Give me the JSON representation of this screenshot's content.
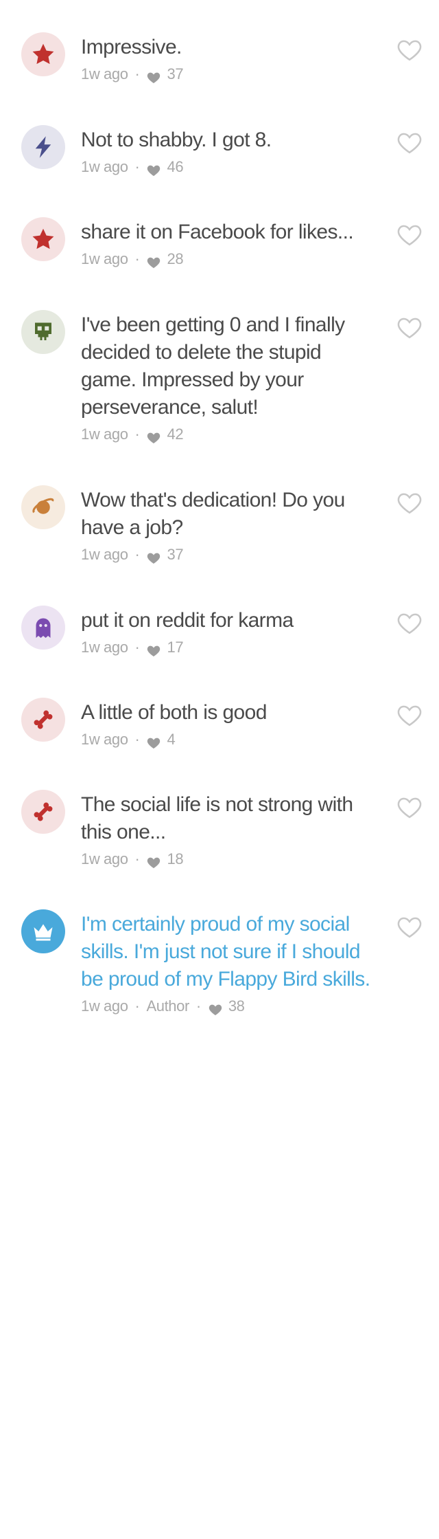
{
  "comments": [
    {
      "text": "Impressive.",
      "time": "1w ago",
      "likes": "37",
      "icon": "star-icon",
      "icon_color": "#c0312e",
      "bg": "#f5e1e1",
      "author": false,
      "author_label": ""
    },
    {
      "text": "Not to shabby.  I got 8.",
      "time": "1w ago",
      "likes": "46",
      "icon": "lightning-icon",
      "icon_color": "#4a4f8c",
      "bg": "#e4e4ee",
      "author": false,
      "author_label": ""
    },
    {
      "text": "share it on Facebook for likes...",
      "time": "1w ago",
      "likes": "28",
      "icon": "star-icon",
      "icon_color": "#c0312e",
      "bg": "#f5e1e1",
      "author": false,
      "author_label": ""
    },
    {
      "text": "I've been getting 0 and I finally decided to delete the stupid game. Impressed by your perseverance, salut!",
      "time": "1w ago",
      "likes": "42",
      "icon": "skull-icon",
      "icon_color": "#4f6b2e",
      "bg": "#e5e9df",
      "author": false,
      "author_label": ""
    },
    {
      "text": "Wow that's dedication! Do you have a job?",
      "time": "1w ago",
      "likes": "37",
      "icon": "planet-icon",
      "icon_color": "#c9803a",
      "bg": "#f6ebdf",
      "author": false,
      "author_label": ""
    },
    {
      "text": "put it on reddit for karma",
      "time": "1w ago",
      "likes": "17",
      "icon": "ghost-icon",
      "icon_color": "#7b4bb0",
      "bg": "#ece3f2",
      "author": false,
      "author_label": ""
    },
    {
      "text": "A little of both is good",
      "time": "1w ago",
      "likes": "4",
      "icon": "bone-icon",
      "icon_color": "#c0312e",
      "bg": "#f5e1e1",
      "author": false,
      "author_label": ""
    },
    {
      "text": "The social life is not strong with this one...",
      "time": "1w ago",
      "likes": "18",
      "icon": "bone-icon",
      "icon_color": "#c0312e",
      "bg": "#f5e1e1",
      "author": false,
      "author_label": ""
    },
    {
      "text": "I'm certainly proud of my social skills. I'm just not sure if I should be proud of my Flappy Bird skills.",
      "time": "1w ago",
      "likes": "38",
      "icon": "crown-icon",
      "icon_color": "#ffffff",
      "bg": "#49a9db",
      "author": true,
      "author_label": "Author"
    }
  ],
  "colors": {
    "text": "#4a4a4a",
    "meta": "#a9a9a9",
    "author_text": "#49a9db",
    "heart_outline": "#c8c8c8"
  }
}
